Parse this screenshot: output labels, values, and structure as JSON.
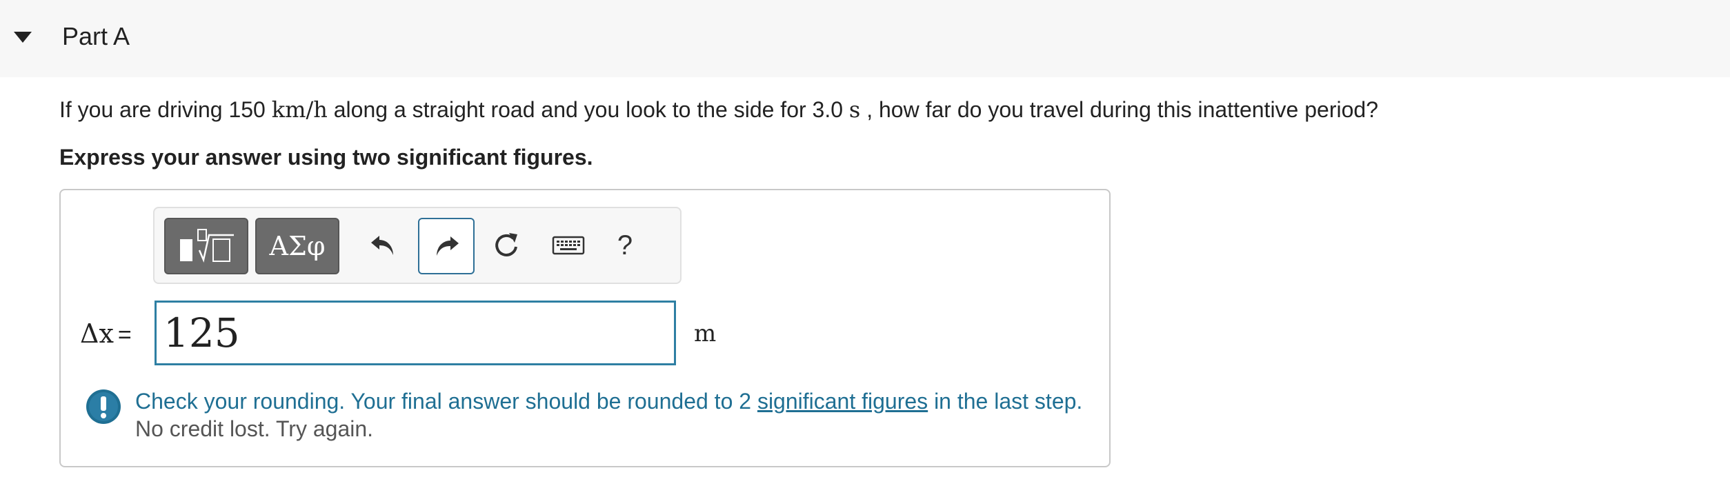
{
  "part": {
    "title": "Part A"
  },
  "question": {
    "text_before": "If you are driving 150",
    "speed_unit": "km/h",
    "text_middle": "along a straight road and you look to the side for 3.0",
    "time_unit": "s",
    "text_after": ", how far do you travel during this inattentive period?"
  },
  "instruction": "Express your answer using two significant figures.",
  "toolbar": {
    "symbols_label": "ΑΣφ",
    "help_label": "?",
    "icons": [
      "templates-icon",
      "undo-icon",
      "redo-icon",
      "reset-icon",
      "keyboard-icon"
    ]
  },
  "answer": {
    "variable": "Δx",
    "equals": "=",
    "value": "125",
    "unit": "m"
  },
  "feedback": {
    "text_before": "Check your rounding. Your final answer should be rounded to 2",
    "link_text": "significant figures",
    "text_after": "in the last step.",
    "subtext": "No credit lost. Try again.",
    "color": "#1f6f93"
  },
  "colors": {
    "accent": "#2e7fa3",
    "header_bg": "#f7f7f7"
  }
}
